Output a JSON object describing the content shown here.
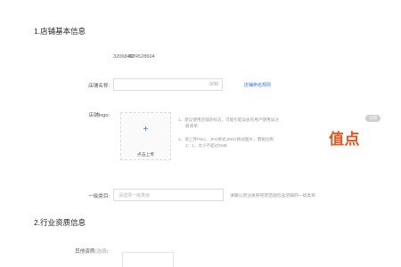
{
  "sections": {
    "basic_title": "1.店铺基本信息",
    "qualification_title": "2.行业资质信息"
  },
  "id_row": {
    "label": "ID:",
    "value": "320684674528604"
  },
  "store_name": {
    "label": "店铺名称:",
    "counter": "0/30",
    "rules_link": "店铺命名规则"
  },
  "logo": {
    "label": "店铺logo:",
    "upload_plus": "+",
    "upload_text": "点击上传",
    "tip1": "1、建议使用店铺的标志，可能引起误会的用户使用误注",
    "tip1b": "册清单",
    "tip2": "2、请上传PNG、JPG格式JPEG格式图片，需要比例",
    "tip2b": "1：1，大小不超过5MB",
    "example_tag": "示例",
    "example_logo": "值点"
  },
  "category": {
    "label": "一级类目:",
    "placeholder": "请选择一级类目",
    "hint": "请确认营业执照经营范围包含店铺的一级类目"
  },
  "other_qualification": {
    "label": "其他资质",
    "optional": "(选填):"
  }
}
